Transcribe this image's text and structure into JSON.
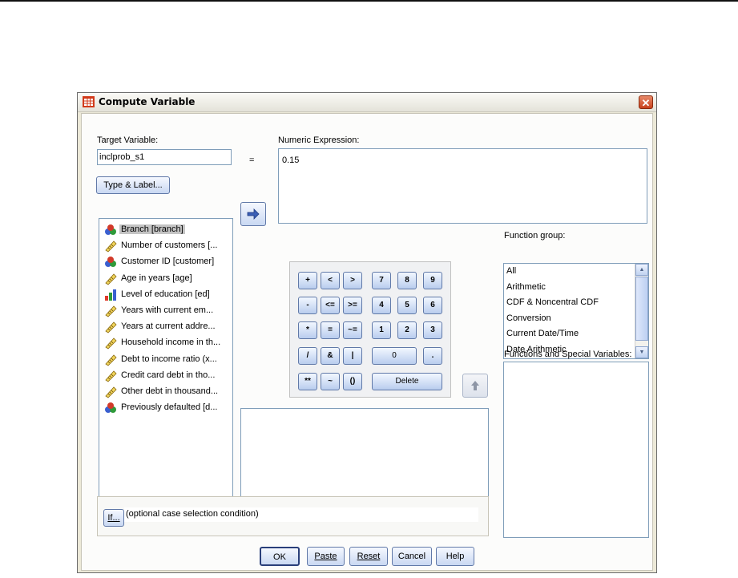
{
  "window": {
    "title": "Compute Variable"
  },
  "target": {
    "label": "Target Variable:",
    "value": "inclprob_s1",
    "equals": "=",
    "type_label_button": "Type & Label..."
  },
  "expression": {
    "label": "Numeric Expression:",
    "value": "0.15"
  },
  "variables": [
    {
      "label": "Branch [branch]",
      "icon": "nominal-icon",
      "selected": true
    },
    {
      "label": "Number of customers [...",
      "icon": "scale-icon"
    },
    {
      "label": "Customer ID [customer]",
      "icon": "nominal-icon"
    },
    {
      "label": "Age in years [age]",
      "icon": "scale-icon"
    },
    {
      "label": "Level of education [ed]",
      "icon": "ordinal-icon"
    },
    {
      "label": "Years with current em...",
      "icon": "scale-icon"
    },
    {
      "label": "Years at current addre...",
      "icon": "scale-icon"
    },
    {
      "label": "Household income in th...",
      "icon": "scale-icon"
    },
    {
      "label": "Debt to income ratio (x...",
      "icon": "scale-icon"
    },
    {
      "label": "Credit card debt in tho...",
      "icon": "scale-icon"
    },
    {
      "label": "Other debt in thousand...",
      "icon": "scale-icon"
    },
    {
      "label": "Previously defaulted [d...",
      "icon": "nominal-icon"
    }
  ],
  "keypad": {
    "row1": [
      "+",
      "<",
      ">",
      "7",
      "8",
      "9"
    ],
    "row2": [
      "-",
      "<=",
      ">=",
      "4",
      "5",
      "6"
    ],
    "row3": [
      "*",
      "=",
      "~=",
      "1",
      "2",
      "3"
    ],
    "row4": [
      "/",
      "&",
      "|",
      "0",
      "."
    ],
    "row5": [
      "**",
      "~",
      "()",
      "Delete"
    ]
  },
  "function_group": {
    "label": "Function group:",
    "items": [
      "All",
      "Arithmetic",
      "CDF & Noncentral CDF",
      "Conversion",
      "Current Date/Time",
      "Date Arithmetic"
    ]
  },
  "functions_special": {
    "label": "Functions and Special Variables:"
  },
  "if_section": {
    "button": "If...",
    "text": "(optional case selection condition)"
  },
  "buttons": {
    "ok": "OK",
    "paste": "Paste",
    "reset": "Reset",
    "cancel": "Cancel",
    "help": "Help"
  },
  "colors": {
    "title_bar": "#f3f1ea",
    "button": "#c9d8f2",
    "close": "#c8411c",
    "arrow": "#3b5fb5"
  }
}
